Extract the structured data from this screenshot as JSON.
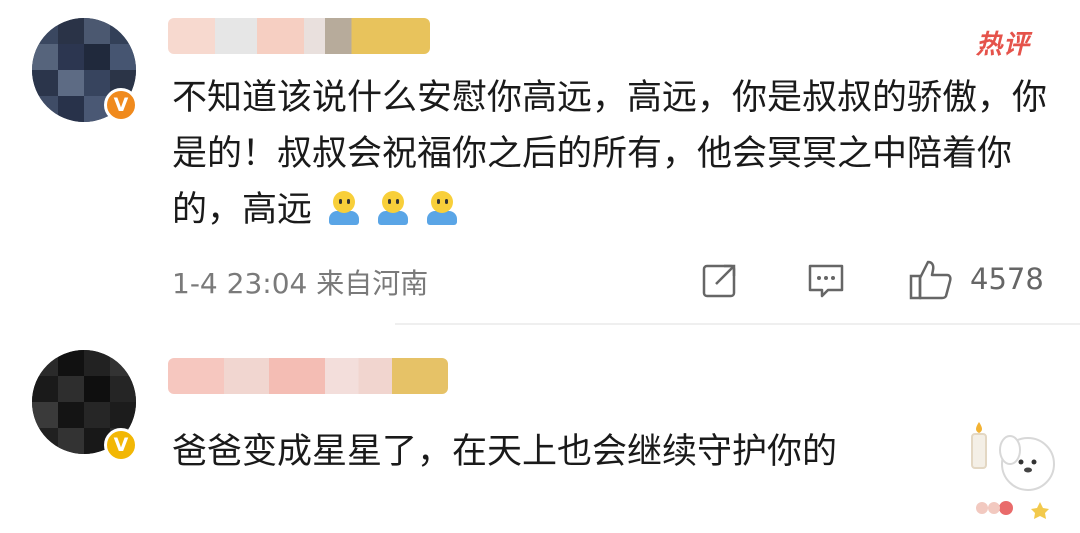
{
  "comments": [
    {
      "hot_tag": "热评",
      "text": "不知道该说什么安慰你高远，高远，你是叔叔的骄傲，你是的！叔叔会祝福你之后的所有，他会冥冥之中陪着你的，高远",
      "emoji_count": 3,
      "meta": "1-4 23:04 来自河南",
      "likes": "4578",
      "badge_color": "#f08a1d",
      "icons": [
        "share-icon",
        "comment-icon",
        "like-icon"
      ]
    },
    {
      "text": "爸爸变成星星了，在天上也会继续守护你的",
      "badge_color": "#f2b705"
    }
  ]
}
